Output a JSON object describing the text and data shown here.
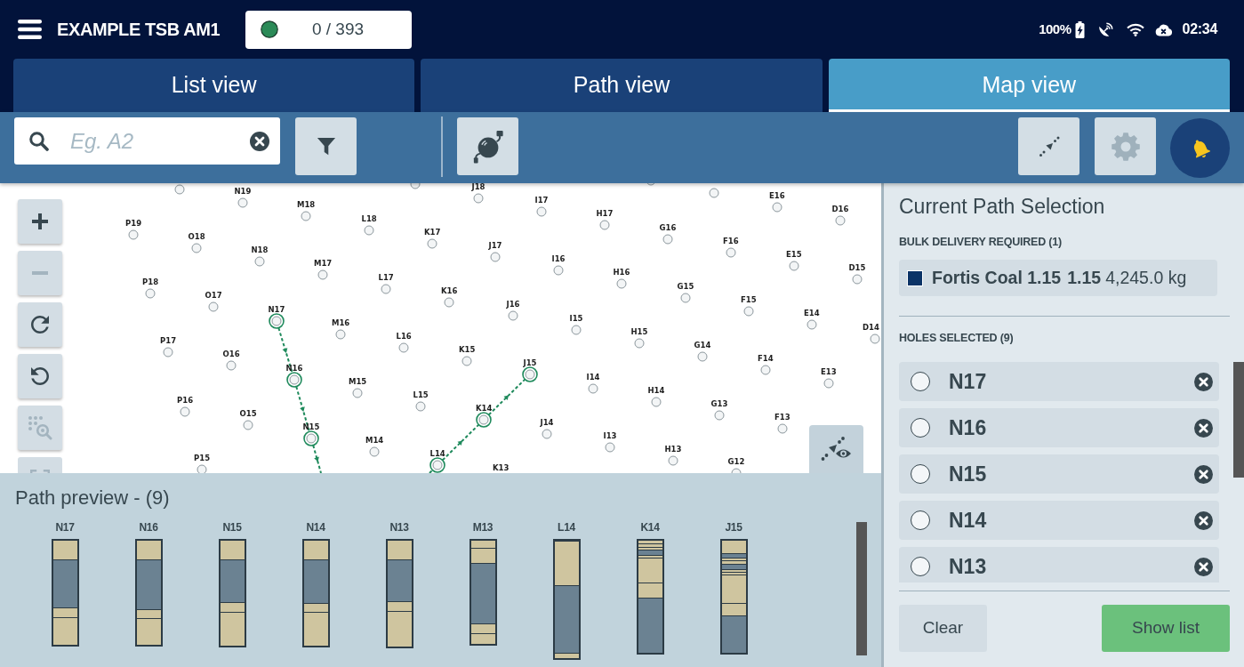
{
  "app_bar": {
    "title": "EXAMPLE TSB AM1",
    "counter": "0 / 393",
    "battery": "100%",
    "time": "02:34"
  },
  "tabs": [
    {
      "label": "List view",
      "selected": false
    },
    {
      "label": "Path view",
      "selected": false
    },
    {
      "label": "Map view",
      "selected": true
    }
  ],
  "toolbar": {
    "search": {
      "placeholder": "Eg. A2"
    },
    "buttons": [
      {
        "disabled": false
      },
      {
        "disabled": false
      },
      {
        "disabled": false
      },
      {
        "disabled": true
      },
      {
        "disabled": false
      }
    ]
  },
  "map": {
    "controls": [
      {
        "disabled": false
      },
      {
        "disabled": true
      },
      {
        "disabled": false
      },
      {
        "disabled": false
      },
      {
        "disabled": true
      },
      {
        "disabled": true
      }
    ],
    "holes": [
      {
        "selected": false
      },
      {
        "selected": false
      },
      {
        "selected": false
      },
      {
        "selected": false
      },
      {
        "label": "J18",
        "selected": false
      },
      {
        "label": "N19",
        "selected": false
      },
      {
        "label": "E16",
        "selected": false
      },
      {
        "label": "I17",
        "selected": false
      },
      {
        "label": "M18",
        "selected": false
      },
      {
        "label": "D16",
        "selected": false
      },
      {
        "label": "H17",
        "selected": false
      },
      {
        "label": "L18",
        "selected": false
      },
      {
        "label": "P19",
        "selected": false
      },
      {
        "label": "G16",
        "selected": false
      },
      {
        "label": "K17",
        "selected": false
      },
      {
        "label": "O18",
        "selected": false
      },
      {
        "label": "F16",
        "selected": false
      },
      {
        "label": "J17",
        "selected": false
      },
      {
        "label": "N18",
        "selected": false
      },
      {
        "label": "E15",
        "selected": false
      },
      {
        "label": "I16",
        "selected": false
      },
      {
        "label": "M17",
        "selected": false
      },
      {
        "label": "D15",
        "selected": false
      },
      {
        "label": "H16",
        "selected": false
      },
      {
        "label": "L17",
        "selected": false
      },
      {
        "label": "P18",
        "selected": false
      },
      {
        "label": "G15",
        "selected": false
      },
      {
        "label": "K16",
        "selected": false
      },
      {
        "label": "O17",
        "selected": false
      },
      {
        "label": "F15",
        "selected": false
      },
      {
        "label": "J16",
        "selected": false
      },
      {
        "label": "N17",
        "selected": true
      },
      {
        "label": "E14",
        "selected": false
      },
      {
        "label": "I15",
        "selected": false
      },
      {
        "label": "M16",
        "selected": false
      },
      {
        "label": "D14",
        "selected": false
      },
      {
        "label": "H15",
        "selected": false
      },
      {
        "label": "L16",
        "selected": false
      },
      {
        "label": "P17",
        "selected": false
      },
      {
        "label": "G14",
        "selected": false
      },
      {
        "label": "K15",
        "selected": false
      },
      {
        "label": "O16",
        "selected": false
      },
      {
        "label": "F14",
        "selected": false
      },
      {
        "label": "J15",
        "selected": true
      },
      {
        "label": "N16",
        "selected": true
      },
      {
        "label": "E13",
        "selected": false
      },
      {
        "label": "I14",
        "selected": false
      },
      {
        "label": "M15",
        "selected": false
      },
      {
        "label": "H14",
        "selected": false
      },
      {
        "label": "L15",
        "selected": false
      },
      {
        "label": "P16",
        "selected": false
      },
      {
        "label": "G13",
        "selected": false
      },
      {
        "label": "K14",
        "selected": true
      },
      {
        "label": "O15",
        "selected": false
      },
      {
        "label": "F13",
        "selected": false
      },
      {
        "label": "J14",
        "selected": false
      },
      {
        "label": "N15",
        "selected": true
      },
      {
        "label": "I13",
        "selected": false
      },
      {
        "label": "M14",
        "selected": false
      },
      {
        "label": "H13",
        "selected": false
      },
      {
        "label": "L14",
        "selected": true
      },
      {
        "label": "P15",
        "selected": false
      },
      {
        "label": "G12",
        "selected": false
      },
      {
        "label": "K13",
        "selected": false
      }
    ]
  },
  "path_preview": {
    "title": "Path preview - (9)",
    "cores": [
      {
        "label": "N17"
      },
      {
        "label": "N16"
      },
      {
        "label": "N15"
      },
      {
        "label": "N14"
      },
      {
        "label": "N13"
      },
      {
        "label": "M13"
      },
      {
        "label": "L14"
      },
      {
        "label": "K14"
      },
      {
        "label": "J15"
      }
    ]
  },
  "selection_panel": {
    "title": "Current Path Selection",
    "bulk_heading": "BULK DELIVERY REQUIRED (1)",
    "bulk_items": [
      {
        "color": "#0b3366",
        "product": "Fortis Coal 1.15",
        "grade": "1.15",
        "weight": "4,245.0 kg"
      }
    ],
    "holes_heading": "HOLES SELECTED (9)",
    "holes": [
      {
        "label": "N17",
        "checked": false
      },
      {
        "label": "N16",
        "checked": false
      },
      {
        "label": "N15",
        "checked": false
      },
      {
        "label": "N14",
        "checked": false
      },
      {
        "label": "N13",
        "checked": false
      }
    ],
    "buttons": [
      {
        "label": "Clear",
        "kind": "secondary"
      },
      {
        "label": "Show list",
        "kind": "primary"
      }
    ]
  }
}
